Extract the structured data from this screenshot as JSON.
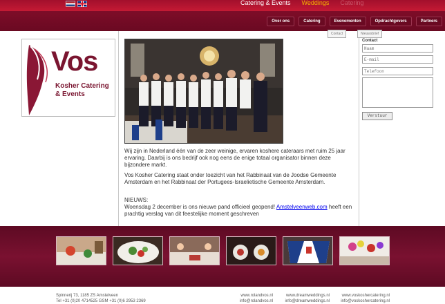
{
  "header": {
    "top_nav": [
      "Catering & Events",
      "Weddings",
      "Catering"
    ],
    "sub_nav": [
      "Over ons",
      "Catering",
      "Evenementen",
      "Opdrachtgevers",
      "Partners"
    ],
    "buttons": {
      "contact": "Contact",
      "nieuwsbrief": "Nieuwsbrief"
    }
  },
  "logo": {
    "name": "Vos",
    "line1": "Kosher Catering",
    "line2": "& Events"
  },
  "content": {
    "p1": "Wij zijn in Nederland één van de zeer weinige, ervaren koshere cateraars met ruim 25 jaar ervaring. Daarbij is ons bedrijf ook nog eens de enige totaal organisator binnen deze bijzondere markt.",
    "p2": "Vos Kosher Catering staat onder toezicht van het Rabbinaat van de Joodse Gemeente Amsterdam en het Rabbinaat der Portugees-Israelietische Gemeente Amsterdam.",
    "news_label": "NIEUWS:",
    "news_pre": "Woensdag 2 december is ons nieuwe pand officieel geopend! ",
    "news_link": "Amstelveenweb.com",
    "news_post": " heeft een prachtig verslag van dit feestelijke moment geschreven"
  },
  "contact_form": {
    "label": "Contact",
    "naam_placeholder": "Naam",
    "email_placeholder": "E-mail",
    "telefoon_placeholder": "Telefoon",
    "submit_label": "Verstuur"
  },
  "footer": {
    "address_line1": "Spinnerij 73, 1185 ZS Amstelveen",
    "address_line2": "Tel +31 (0)20 4714525 GSM +31 (0)6 2953 2369",
    "links": [
      {
        "web": "www.rolandvos.nl",
        "mail": "info@rolandvos.nl"
      },
      {
        "web": "www.dreamweddings.nl",
        "mail": "info@dreamweddings.nl"
      },
      {
        "web": "www.voskoshercatering.nl",
        "mail": "info@voskoshercatering.nl"
      }
    ]
  },
  "colors": {
    "brand": "#7a1530",
    "header_red": "#c41a34",
    "accent_yellow": "#f5b400"
  }
}
